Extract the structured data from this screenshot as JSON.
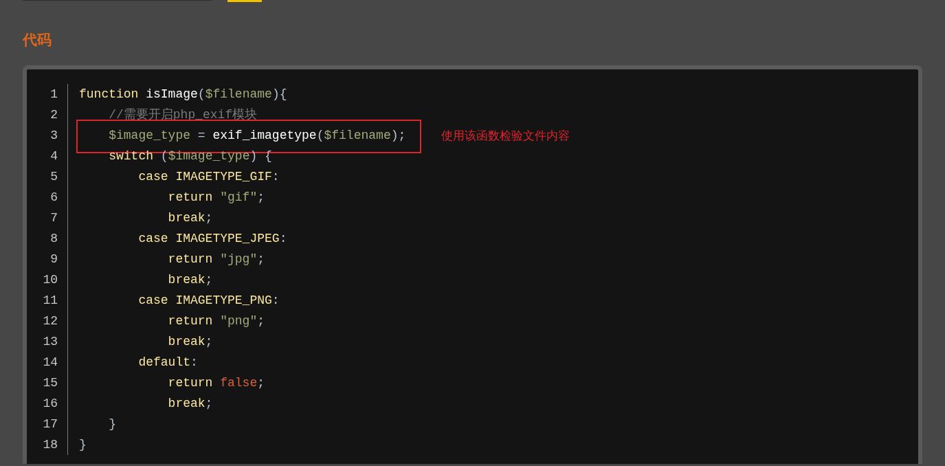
{
  "heading": "代码",
  "code": {
    "lines": [
      {
        "number": "1",
        "tokens": [
          {
            "kind": "keyword",
            "text": "function "
          },
          {
            "kind": "name",
            "text": "isImage"
          },
          {
            "kind": "punct",
            "text": "("
          },
          {
            "kind": "variable",
            "text": "$filename"
          },
          {
            "kind": "punct",
            "text": "){"
          }
        ],
        "children": [
          {
            "number": "2",
            "tokens": [
              {
                "kind": "comment",
                "text": "//需要开启php_exif模块"
              }
            ]
          },
          {
            "number": "3",
            "boxed": true,
            "note": "使用该函数检验文件内容",
            "tokens": [
              {
                "kind": "variable",
                "text": "$image_type"
              },
              {
                "kind": "punct",
                "text": " = "
              },
              {
                "kind": "name",
                "text": "exif_imagetype"
              },
              {
                "kind": "punct",
                "text": "("
              },
              {
                "kind": "variable",
                "text": "$filename"
              },
              {
                "kind": "punct",
                "text": ");"
              }
            ]
          },
          {
            "number": "4",
            "tokens": [
              {
                "kind": "keyword",
                "text": "switch "
              },
              {
                "kind": "punct",
                "text": "("
              },
              {
                "kind": "variable",
                "text": "$image_type"
              },
              {
                "kind": "punct",
                "text": ") {"
              }
            ],
            "children": [
              {
                "number": "5",
                "tokens": [
                  {
                    "kind": "keyword",
                    "text": "case IMAGETYPE_GIF"
                  },
                  {
                    "kind": "punct",
                    "text": ":"
                  }
                ],
                "children": [
                  {
                    "number": "6",
                    "tokens": [
                      {
                        "kind": "keyword",
                        "text": "return "
                      },
                      {
                        "kind": "string",
                        "text": "\"gif\""
                      },
                      {
                        "kind": "punct",
                        "text": ";"
                      }
                    ]
                  },
                  {
                    "number": "7",
                    "tokens": [
                      {
                        "kind": "keyword",
                        "text": "break"
                      },
                      {
                        "kind": "punct",
                        "text": ";"
                      }
                    ]
                  }
                ]
              },
              {
                "number": "8",
                "tokens": [
                  {
                    "kind": "keyword",
                    "text": "case IMAGETYPE_JPEG"
                  },
                  {
                    "kind": "punct",
                    "text": ":"
                  }
                ],
                "children": [
                  {
                    "number": "9",
                    "tokens": [
                      {
                        "kind": "keyword",
                        "text": "return "
                      },
                      {
                        "kind": "string",
                        "text": "\"jpg\""
                      },
                      {
                        "kind": "punct",
                        "text": ";"
                      }
                    ]
                  },
                  {
                    "number": "10",
                    "tokens": [
                      {
                        "kind": "keyword",
                        "text": "break"
                      },
                      {
                        "kind": "punct",
                        "text": ";"
                      }
                    ]
                  }
                ]
              },
              {
                "number": "11",
                "tokens": [
                  {
                    "kind": "keyword",
                    "text": "case IMAGETYPE_PNG"
                  },
                  {
                    "kind": "punct",
                    "text": ":"
                  }
                ],
                "children": [
                  {
                    "number": "12",
                    "tokens": [
                      {
                        "kind": "keyword",
                        "text": "return "
                      },
                      {
                        "kind": "string",
                        "text": "\"png\""
                      },
                      {
                        "kind": "punct",
                        "text": ";"
                      }
                    ]
                  },
                  {
                    "number": "13",
                    "tokens": [
                      {
                        "kind": "keyword",
                        "text": "break"
                      },
                      {
                        "kind": "punct",
                        "text": ";"
                      }
                    ]
                  }
                ]
              },
              {
                "number": "14",
                "tokens": [
                  {
                    "kind": "keyword",
                    "text": "default"
                  },
                  {
                    "kind": "punct",
                    "text": ":"
                  }
                ],
                "children": [
                  {
                    "number": "15",
                    "tokens": [
                      {
                        "kind": "keyword",
                        "text": "return "
                      },
                      {
                        "kind": "constant",
                        "text": "false"
                      },
                      {
                        "kind": "punct",
                        "text": ";"
                      }
                    ]
                  },
                  {
                    "number": "16",
                    "tokens": [
                      {
                        "kind": "keyword",
                        "text": "break"
                      },
                      {
                        "kind": "punct",
                        "text": ";"
                      }
                    ]
                  }
                ]
              }
            ]
          },
          {
            "number": "17",
            "tokens": [
              {
                "kind": "punct",
                "text": "}"
              }
            ]
          }
        ]
      },
      {
        "number": "18",
        "tokens": [
          {
            "kind": "punct",
            "text": "}"
          }
        ]
      }
    ]
  }
}
